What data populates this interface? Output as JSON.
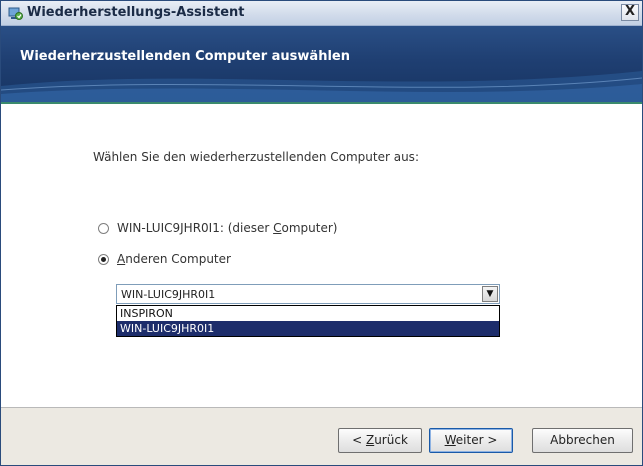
{
  "window": {
    "title": "Wiederherstellungs-Assistent",
    "close_label": "X"
  },
  "banner": {
    "title": "Wiederherzustellenden Computer auswählen"
  },
  "content": {
    "instruction": "Wählen Sie den wiederherzustellenden Computer aus:",
    "radio_this": {
      "prefix": "WIN-LUIC9JHR0I1: (dieser ",
      "underlined": "C",
      "suffix": "omputer)",
      "checked": false
    },
    "radio_other": {
      "underlined": "A",
      "suffix": "nderen Computer",
      "checked": true
    },
    "combo": {
      "value": "WIN-LUIC9JHR0I1",
      "arrow": "▼"
    },
    "options": [
      {
        "label": "INSPIRON",
        "selected": false
      },
      {
        "label": "WIN-LUIC9JHR0I1",
        "selected": true
      }
    ]
  },
  "footer": {
    "back": {
      "prefix": "< ",
      "underlined": "Z",
      "suffix": "urück"
    },
    "next": {
      "underlined": "W",
      "suffix": "eiter >"
    },
    "cancel": {
      "label": "Abbrechen"
    }
  },
  "colors": {
    "banner": "#1f3f72",
    "accent_line": "#3a8a6d",
    "selection": "#1d2d6b"
  }
}
